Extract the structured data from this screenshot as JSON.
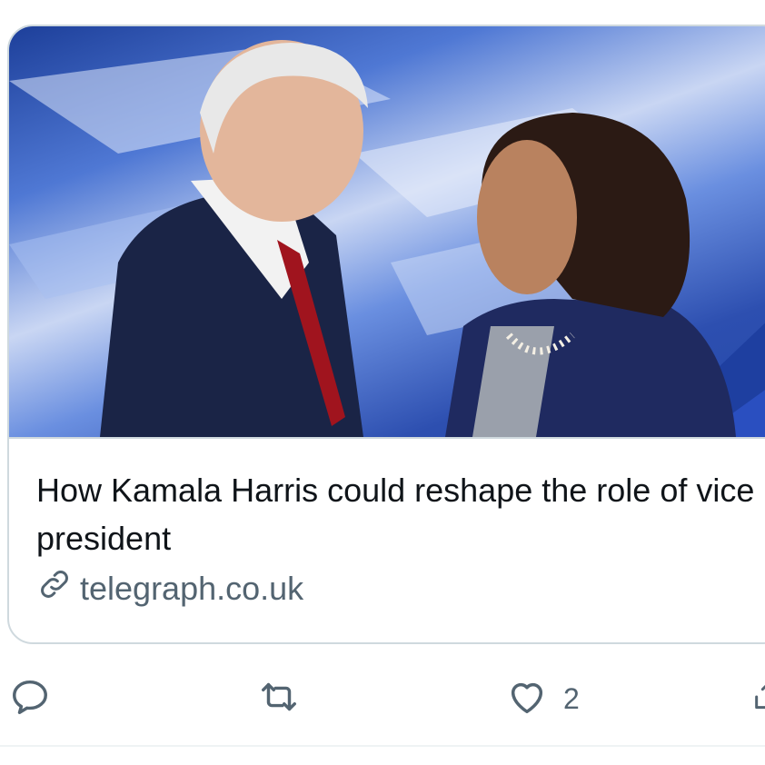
{
  "card": {
    "title": "How Kamala Harris could reshape the role of vice president",
    "domain": "telegraph.co.uk",
    "link_icon": "link-icon",
    "media_alt": "photo"
  },
  "actions": {
    "reply": {
      "icon": "reply-icon",
      "count": ""
    },
    "retweet": {
      "icon": "retweet-icon",
      "count": ""
    },
    "like": {
      "icon": "heart-icon",
      "count": "2"
    },
    "share": {
      "icon": "share-icon",
      "count": ""
    }
  },
  "colors": {
    "text": "#0f1419",
    "secondary": "#536471",
    "border": "#cfd9de"
  }
}
